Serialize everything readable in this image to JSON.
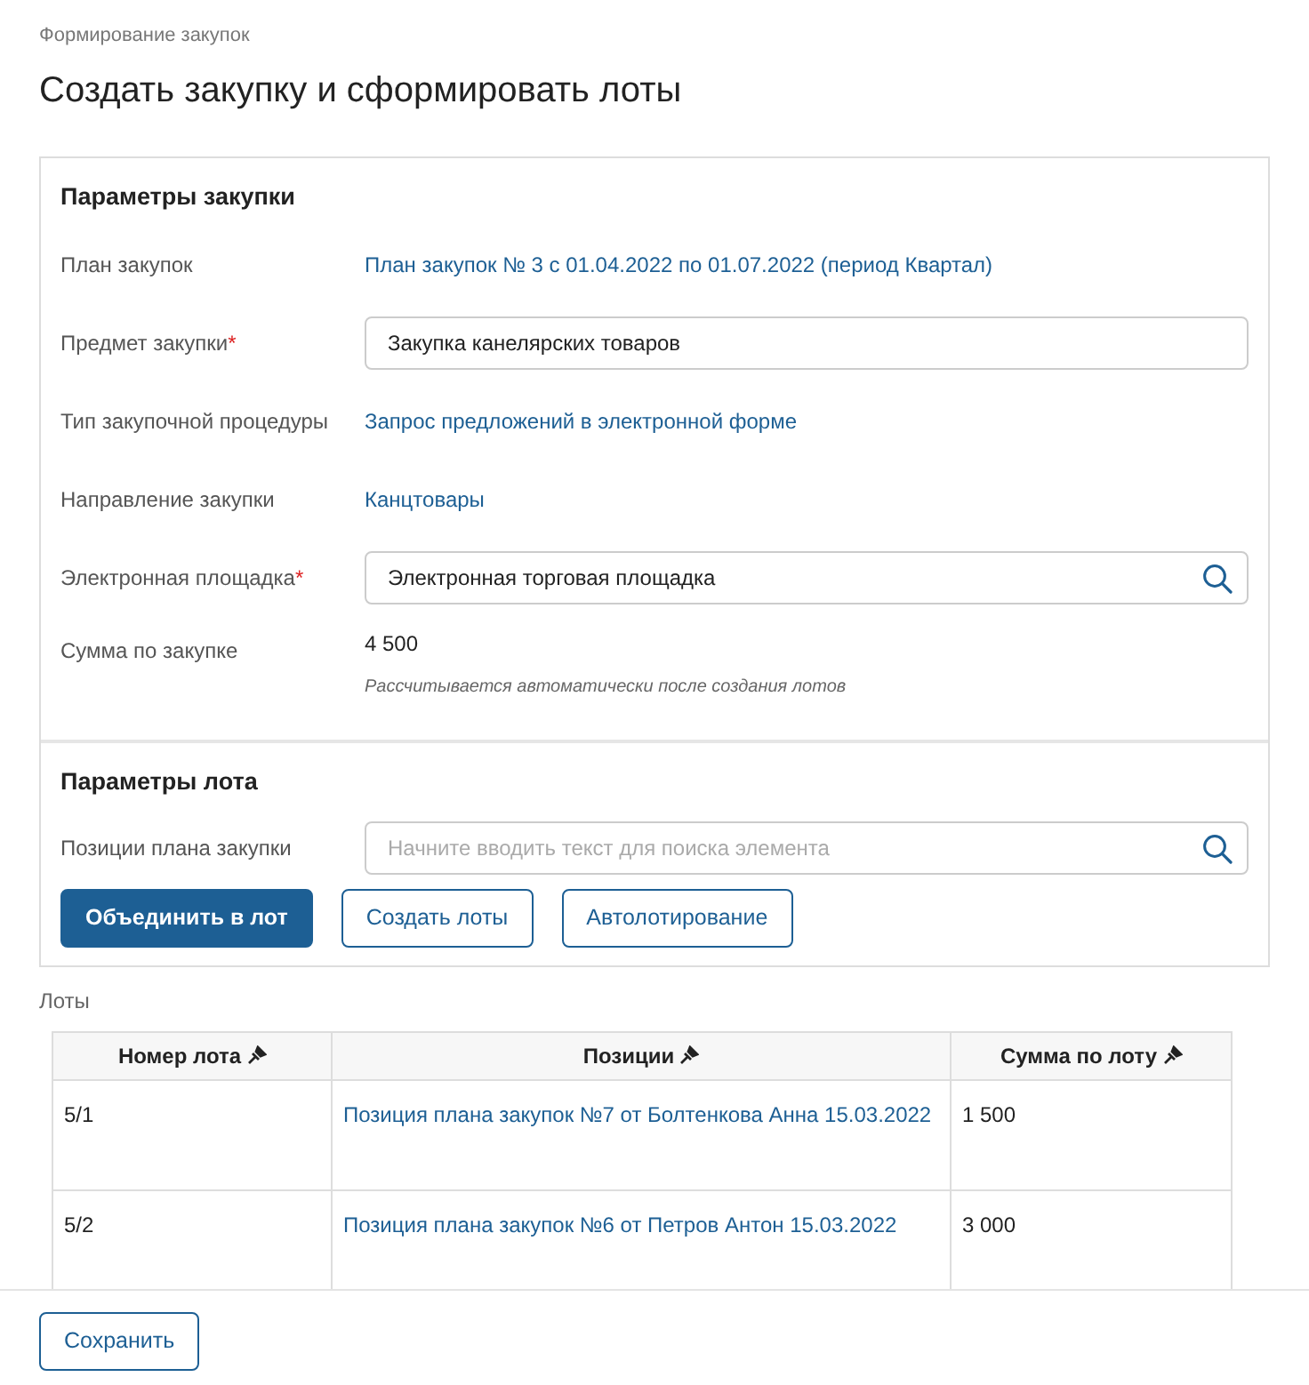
{
  "breadcrumb": "Формирование закупок",
  "title": "Создать закупку и сформировать лоты",
  "purchase_params": {
    "heading": "Параметры закупки",
    "fields": [
      {
        "kind": "link",
        "label": "План закупок",
        "value": "План закупок № 3 с 01.04.2022 по 01.07.2022 (период Квартал)"
      },
      {
        "kind": "input",
        "label": "Предмет закупки",
        "required_mark": "*",
        "value": "Закупка канелярских товаров"
      },
      {
        "kind": "link",
        "label": "Тип закупочной процедуры",
        "value": "Запрос предложений в электронной форме"
      },
      {
        "kind": "link",
        "label": "Направление закупки",
        "value": "Канцтовары"
      },
      {
        "kind": "search",
        "label": "Электронная площадка",
        "required_mark": "*",
        "value": "Электронная торговая площадка"
      },
      {
        "kind": "text",
        "label": "Сумма по закупке",
        "value": "4 500",
        "hint": "Рассчитывается автоматически после создания лотов"
      }
    ]
  },
  "lot_params": {
    "heading": "Параметры лота",
    "search": {
      "label": "Позиции плана закупки",
      "placeholder": "Начните вводить текст для поиска элемента"
    },
    "buttons": [
      {
        "label": "Объединить в лот",
        "primary": true
      },
      {
        "label": "Создать лоты",
        "primary": false
      },
      {
        "label": "Автолотирование",
        "primary": false
      }
    ]
  },
  "lots": {
    "label": "Лоты",
    "columns": [
      "Номер лота",
      "Позиции",
      "Сумма по лоту"
    ],
    "rows": [
      {
        "number": "5/1",
        "position": "Позиция плана закупок №7 от Болтенкова Анна 15.03.2022",
        "sum": "1 500"
      },
      {
        "number": "5/2",
        "position": "Позиция плана закупок №6 от Петров Антон 15.03.2022",
        "sum": "3 000"
      }
    ]
  },
  "footer": {
    "save_button": "Сохранить"
  }
}
